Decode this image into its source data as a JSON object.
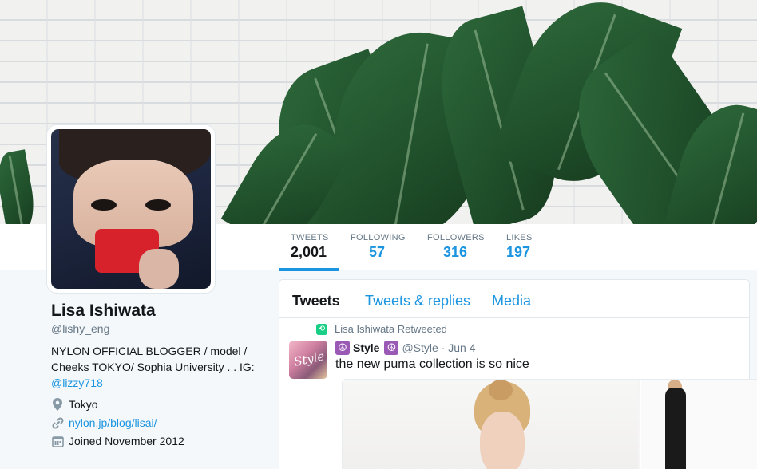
{
  "profile": {
    "name": "Lisa Ishiwata",
    "handle": "@lishy_eng",
    "bio_text": "NYLON OFFICIAL BLOGGER / model / Cheeks TOKYO/ Sophia University . . IG: ",
    "bio_link": "@lizzy718",
    "location": "Tokyo",
    "website": "nylon.jp/blog/lisai/",
    "joined": "Joined November 2012"
  },
  "stats": [
    {
      "label": "TWEETS",
      "value": "2,001",
      "active": true
    },
    {
      "label": "FOLLOWING",
      "value": "57"
    },
    {
      "label": "FOLLOWERS",
      "value": "316"
    },
    {
      "label": "LIKES",
      "value": "197"
    }
  ],
  "tabs": {
    "tweets": "Tweets",
    "replies": "Tweets & replies",
    "media": "Media"
  },
  "tweet": {
    "retweet_label": "Lisa Ishiwata Retweeted",
    "author_name": "Style",
    "author_handle_date": "@Style · Jun 4",
    "text": "the new puma collection is so nice",
    "avatar_text": "Style"
  },
  "icons": {
    "peace": "☮",
    "retweet": "⟲",
    "location": "location-pin-icon",
    "link": "link-icon",
    "calendar": "calendar-icon"
  },
  "colors": {
    "accent": "#1b95e0",
    "retweet": "#19cf86",
    "peace_badge": "#9b59b6"
  }
}
